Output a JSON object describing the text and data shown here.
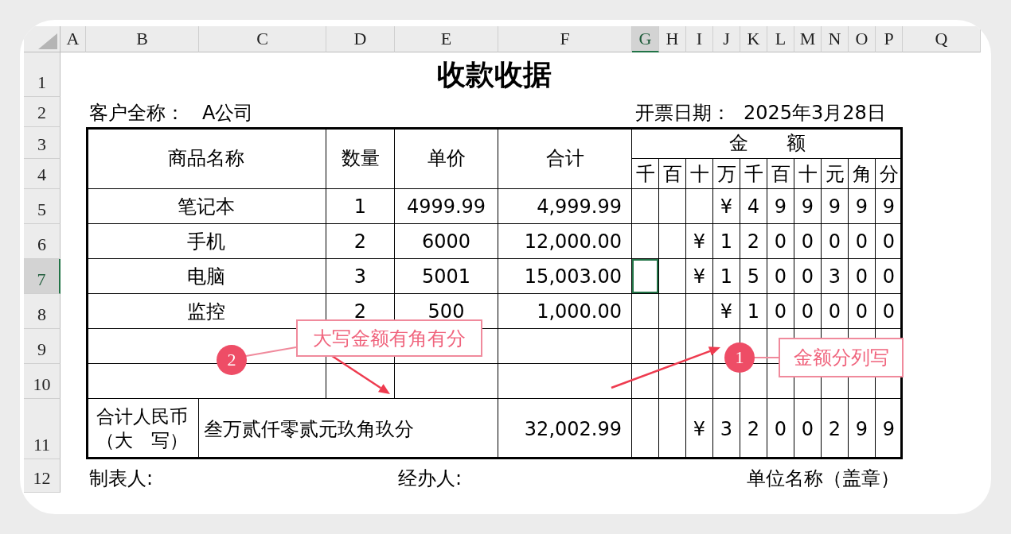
{
  "column_headers": [
    {
      "label": "A",
      "selected": false
    },
    {
      "label": "B",
      "selected": false
    },
    {
      "label": "C",
      "selected": false
    },
    {
      "label": "D",
      "selected": false
    },
    {
      "label": "E",
      "selected": false
    },
    {
      "label": "F",
      "selected": false
    },
    {
      "label": "G",
      "selected": true
    },
    {
      "label": "H",
      "selected": false
    },
    {
      "label": "I",
      "selected": false
    },
    {
      "label": "J",
      "selected": false
    },
    {
      "label": "K",
      "selected": false
    },
    {
      "label": "L",
      "selected": false
    },
    {
      "label": "M",
      "selected": false
    },
    {
      "label": "N",
      "selected": false
    },
    {
      "label": "O",
      "selected": false
    },
    {
      "label": "P",
      "selected": false
    },
    {
      "label": "Q",
      "selected": false
    }
  ],
  "row_headers": [
    {
      "label": "1",
      "selected": false
    },
    {
      "label": "2",
      "selected": false
    },
    {
      "label": "3",
      "selected": false
    },
    {
      "label": "4",
      "selected": false
    },
    {
      "label": "5",
      "selected": false
    },
    {
      "label": "6",
      "selected": false
    },
    {
      "label": "7",
      "selected": true
    },
    {
      "label": "8",
      "selected": false
    },
    {
      "label": "9",
      "selected": false
    },
    {
      "label": "10",
      "selected": false
    },
    {
      "label": "11",
      "selected": false
    },
    {
      "label": "12",
      "selected": false
    }
  ],
  "title": "收款收据",
  "customer": {
    "label": "客户全称：",
    "value": "A公司"
  },
  "date": {
    "label": "开票日期：",
    "value": "2025年3月28日"
  },
  "table": {
    "columns": [
      "商品名称",
      "数量",
      "单价",
      "合计"
    ],
    "amount_header": "金　　额",
    "digit_headers": [
      "千",
      "百",
      "十",
      "万",
      "千",
      "百",
      "十",
      "元",
      "角",
      "分"
    ],
    "rows": [
      {
        "name": "笔记本",
        "quantity": "1",
        "price": "4999.99",
        "total": "4,999.99",
        "digits": [
          "¥",
          "4",
          "9",
          "9",
          "9",
          "9",
          "9"
        ]
      },
      {
        "name": "手机",
        "quantity": "2",
        "price": "6000",
        "total": "12,000.00",
        "digits": [
          "¥",
          "1",
          "2",
          "0",
          "0",
          "0",
          "0",
          "0"
        ]
      },
      {
        "name": "电脑",
        "quantity": "3",
        "price": "5001",
        "total": "15,003.00",
        "digits": [
          "¥",
          "1",
          "5",
          "0",
          "0",
          "3",
          "0",
          "0"
        ]
      },
      {
        "name": "监控",
        "quantity": "2",
        "price": "500",
        "total": "1,000.00",
        "digits": [
          "¥",
          "1",
          "0",
          "0",
          "0",
          "0",
          "0"
        ]
      }
    ],
    "total_row": {
      "label_lines": [
        "合计人民币",
        "（大　写）"
      ],
      "amount_in_words": "叁万贰仟零贰元玖角玖分",
      "total": "32,002.99",
      "digits": [
        "¥",
        "3",
        "2",
        "0",
        "0",
        "2",
        "9",
        "9"
      ]
    }
  },
  "footer": {
    "preparer": "制表人:",
    "handler": "经办人:",
    "company": "单位名称（盖章）"
  },
  "annotations": [
    {
      "number": "2",
      "text": "大写金额有角有分"
    },
    {
      "number": "1",
      "text": "金额分列写"
    }
  ]
}
